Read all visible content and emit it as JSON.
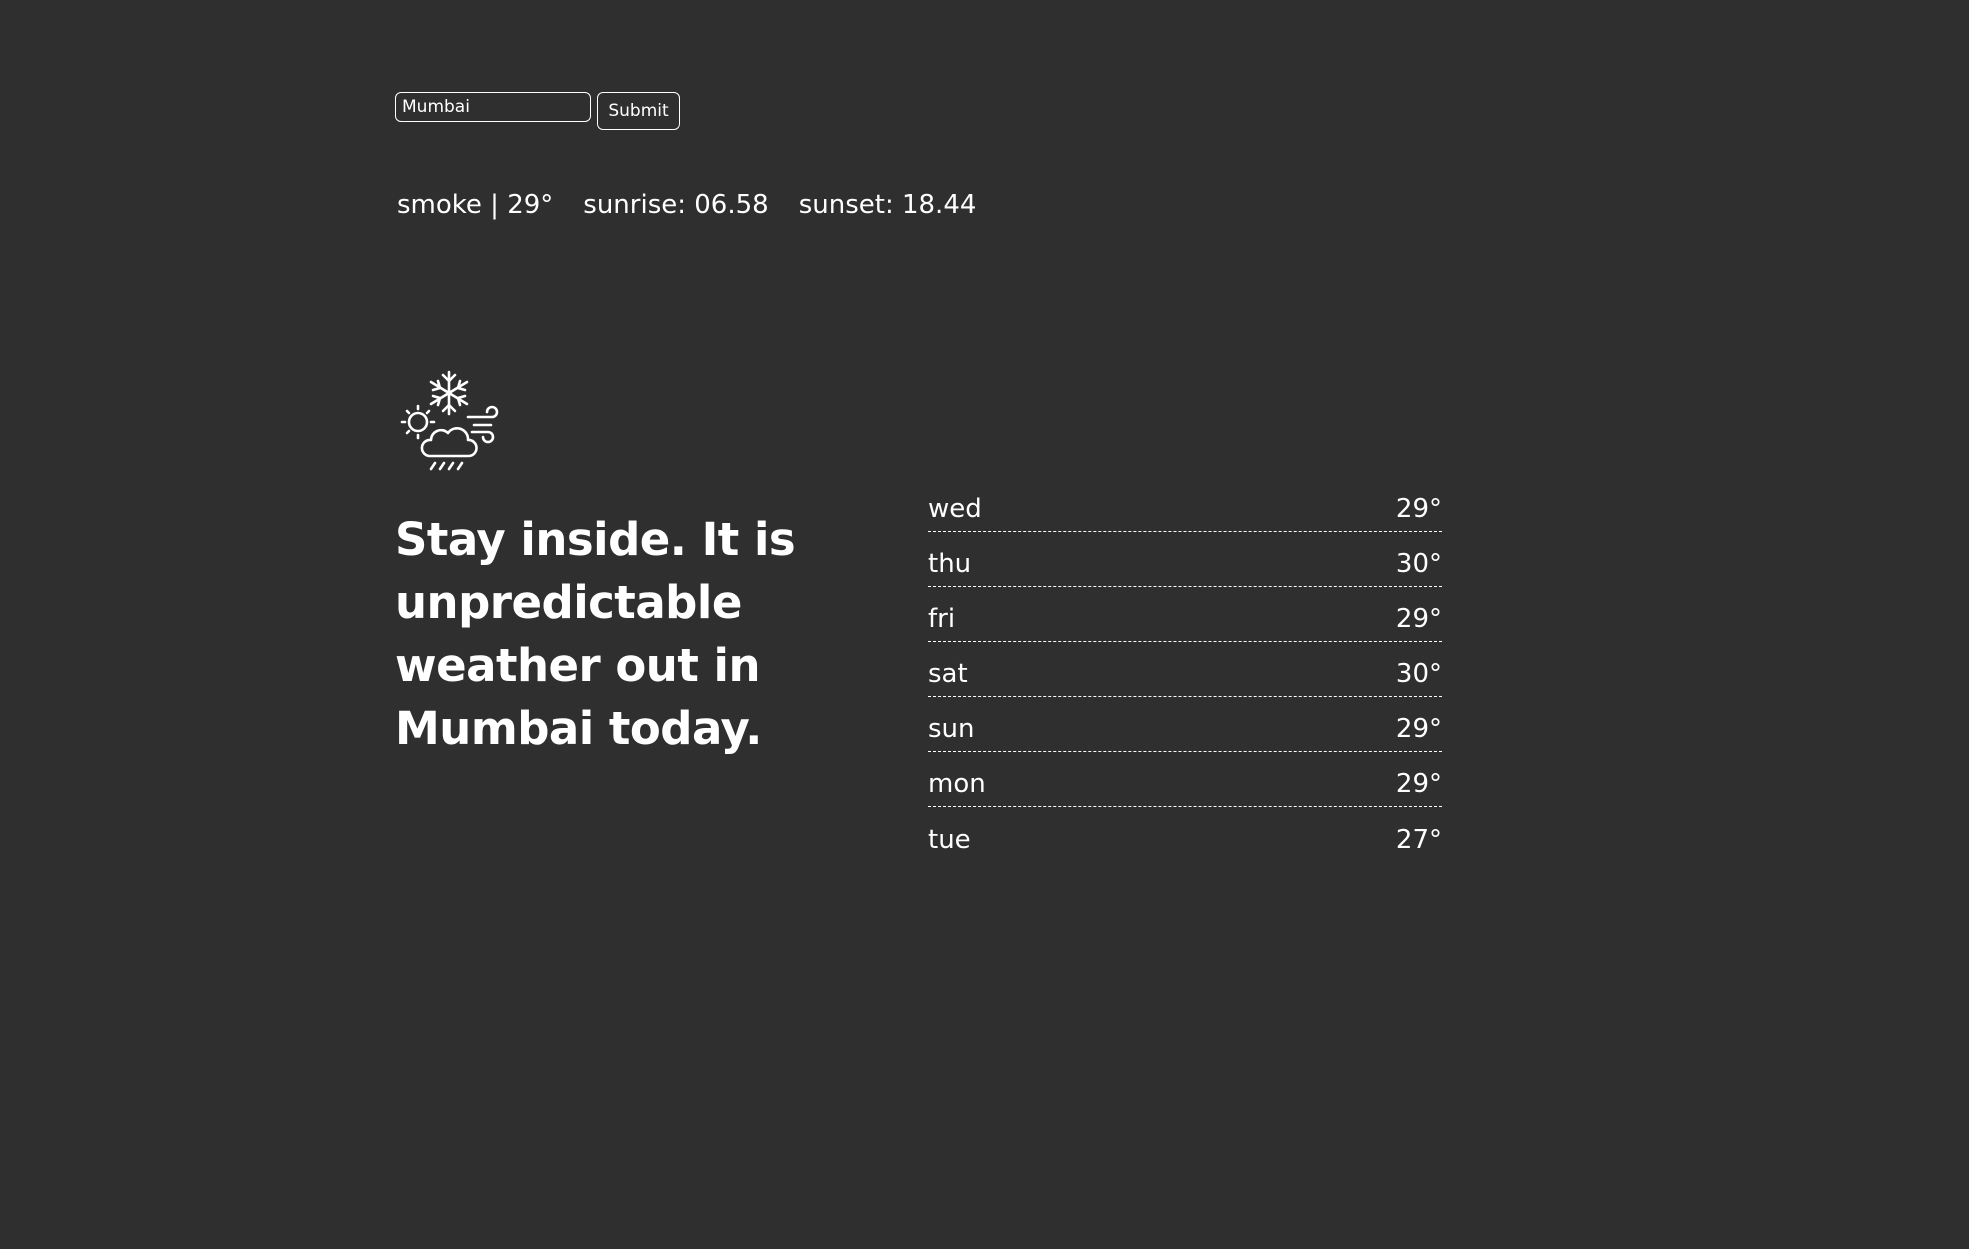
{
  "search": {
    "value": "Mumbai",
    "submit_label": "Submit"
  },
  "current": {
    "condition_temp": "smoke | 29°",
    "sunrise": "sunrise: 06.58",
    "sunset": "sunset: 18.44"
  },
  "icon": "snow-sun-cloud-rain-wind-icon",
  "headline": "Stay inside. It is unpredictable weather out in Mumbai today.",
  "forecast": [
    {
      "day": "wed",
      "temp": "29°"
    },
    {
      "day": "thu",
      "temp": "30°"
    },
    {
      "day": "fri",
      "temp": "29°"
    },
    {
      "day": "sat",
      "temp": "30°"
    },
    {
      "day": "sun",
      "temp": "29°"
    },
    {
      "day": "mon",
      "temp": "29°"
    },
    {
      "day": "tue",
      "temp": "27°"
    }
  ],
  "colors": {
    "background": "#2f2f2f",
    "foreground": "#ffffff"
  }
}
